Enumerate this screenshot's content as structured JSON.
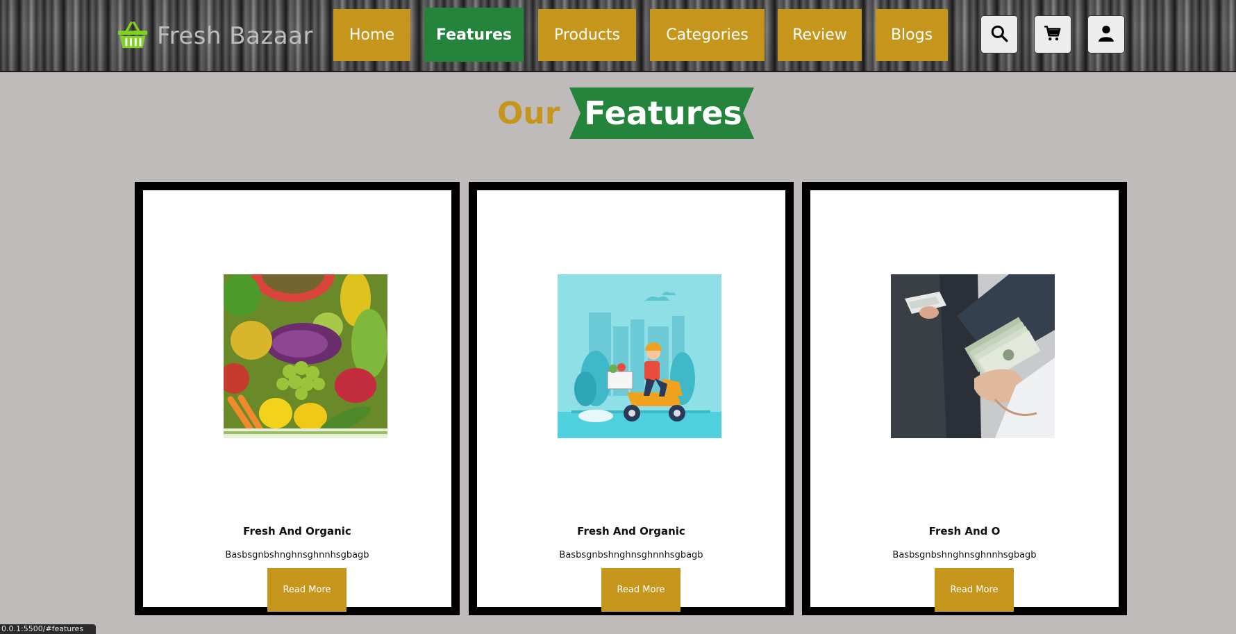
{
  "brand": {
    "name": "Fresh Bazaar",
    "icon": "shopping-basket-icon",
    "icon_color": "#7ed321"
  },
  "nav": {
    "items": [
      {
        "label": "Home",
        "active": false
      },
      {
        "label": "Features",
        "active": true
      },
      {
        "label": "Products",
        "active": false
      },
      {
        "label": "Categories",
        "active": false
      },
      {
        "label": "Review",
        "active": false
      },
      {
        "label": "Blogs",
        "active": false
      }
    ],
    "icons": [
      "search-icon",
      "cart-icon",
      "user-icon"
    ]
  },
  "section": {
    "title_part1": "Our",
    "title_part2": "Features"
  },
  "features": [
    {
      "image": "vegetables-image",
      "title": "Fresh And Organic",
      "text": "Basbsgnbshnghnsghnnhsgbagb",
      "button": "Read More"
    },
    {
      "image": "delivery-scooter-image",
      "title": "Fresh And Organic",
      "text": "Basbsgnbshnghnsghnnhsgbagb",
      "button": "Read More"
    },
    {
      "image": "cash-payment-image",
      "title": "Fresh And O",
      "text": "Basbsgnbshnghnsghnnhsgbagb",
      "button": "Read More"
    }
  ],
  "status_bar": {
    "url": "0.0.1:5500/#features"
  },
  "colors": {
    "gold": "#c6961c",
    "green": "#24843c",
    "background": "#bfbbba"
  }
}
